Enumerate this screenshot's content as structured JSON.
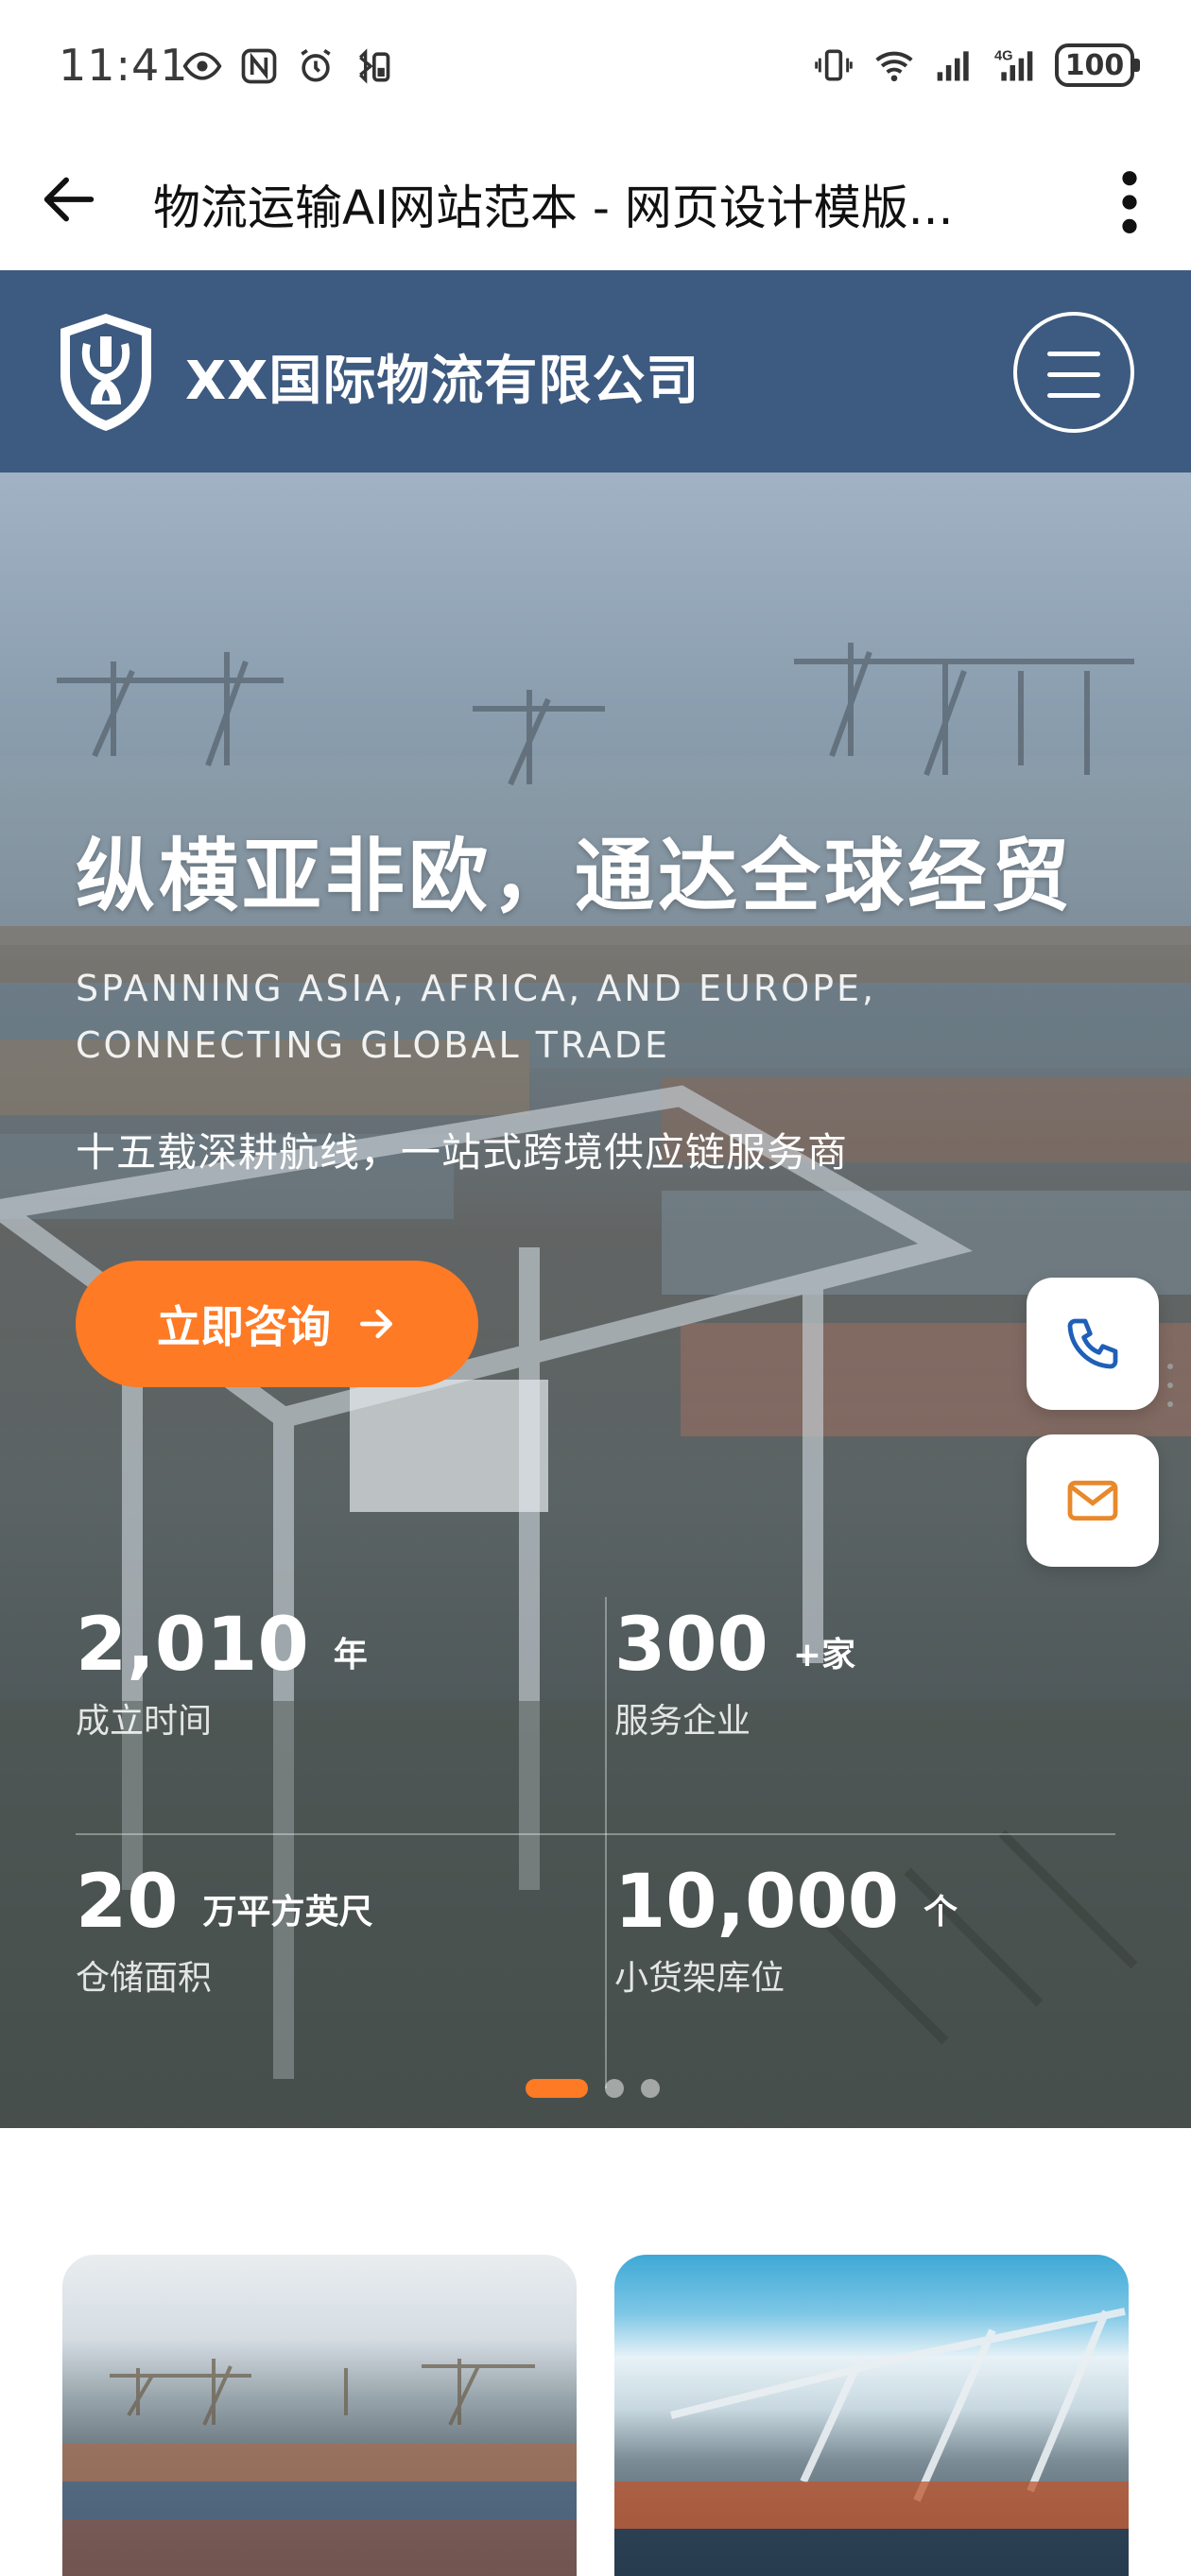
{
  "status_bar": {
    "time": "11:41",
    "battery": "100",
    "network": "4G"
  },
  "browser": {
    "title": "物流运输AI网站范本 - 网页设计模版..."
  },
  "site": {
    "company_name": "XX国际物流有限公司"
  },
  "hero": {
    "title": "纵横亚非欧，通达全球经贸",
    "subtitle_en_line1": "SPANNING ASIA, AFRICA, AND EUROPE,",
    "subtitle_en_line2": "CONNECTING GLOBAL TRADE",
    "tagline": "十五载深耕航线，一站式跨境供应链服务商",
    "cta_label": "立即咨询",
    "stats": [
      {
        "value": "2,010",
        "unit": "年",
        "label": "成立时间"
      },
      {
        "value": "300",
        "unit": "+家",
        "label": "服务企业"
      },
      {
        "value": "20",
        "unit": "万平方英尺",
        "label": "仓储面积"
      },
      {
        "value": "10,000",
        "unit": "个",
        "label": "小货架库位"
      }
    ],
    "carousel": {
      "slides": 3,
      "active": 1
    }
  },
  "floating": {
    "phone_icon": "phone-icon",
    "mail_icon": "mail-icon"
  },
  "colors": {
    "header_bg": "#3d5a80",
    "accent": "#ff7a24",
    "phone_icon": "#1f5fb8",
    "mail_icon": "#e8892b"
  }
}
